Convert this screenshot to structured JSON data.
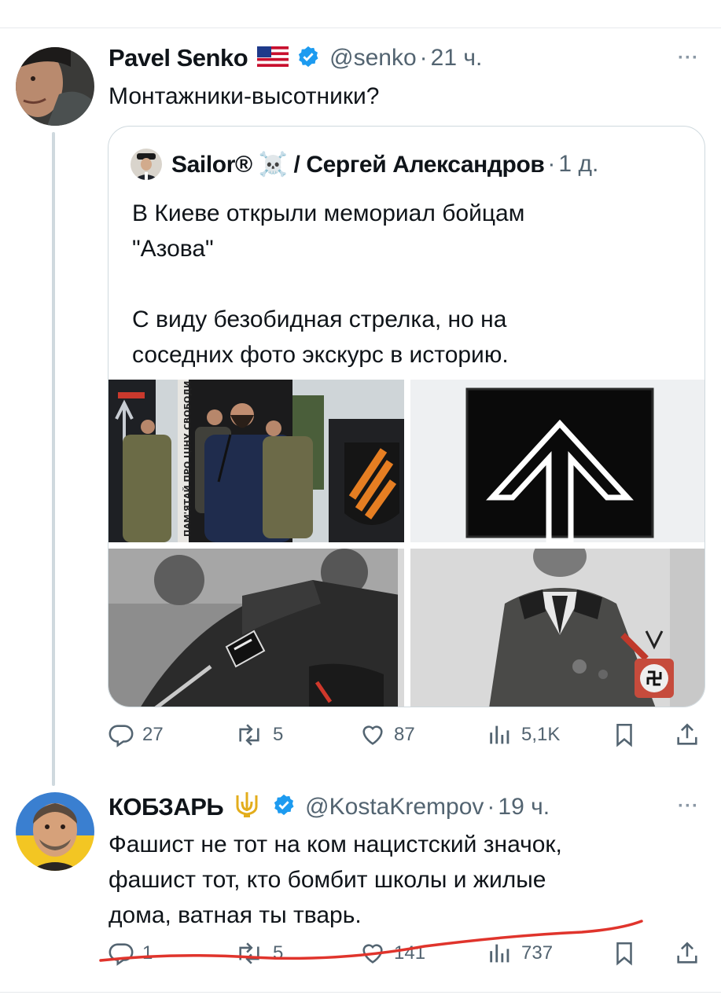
{
  "tweet1": {
    "name": "Pavel Senko",
    "handle": "@senko",
    "time": "21 ч.",
    "text": "Монтажники-высотники?",
    "more": "···"
  },
  "quote": {
    "name": "Sailor® ☠️ / Сергей Александров",
    "time": "1 д.",
    "lines": [
      "В Киеве открыли мемориал бойцам",
      "\"Азова\"",
      "",
      "С виду безобидная стрелка, но на",
      "соседних фото экскурс в историю."
    ],
    "media_sign": "ПАМ'ЯТАЙ ПРО ЦІНУ СВОБОДИ..."
  },
  "tweet1_actions": {
    "replies": "27",
    "reposts": "5",
    "likes": "87",
    "views": "5,1K"
  },
  "tweet2": {
    "name": "КОБЗАРЬ",
    "handle": "@KostaKrempov",
    "time": "19 ч.",
    "lines": [
      "Фашист не тот на ком нацистский значок,",
      "фашист тот, кто бомбит школы и жилые",
      "дома, ватная ты тварь."
    ],
    "more": "···"
  },
  "tweet2_actions": {
    "replies": "1",
    "reposts": "5",
    "likes": "141",
    "views": "737"
  },
  "colors": {
    "text": "#0f1419",
    "muted": "#536471",
    "verified": "#1d9bf0",
    "border": "#cfd9de",
    "scribble": "#e0342c"
  }
}
